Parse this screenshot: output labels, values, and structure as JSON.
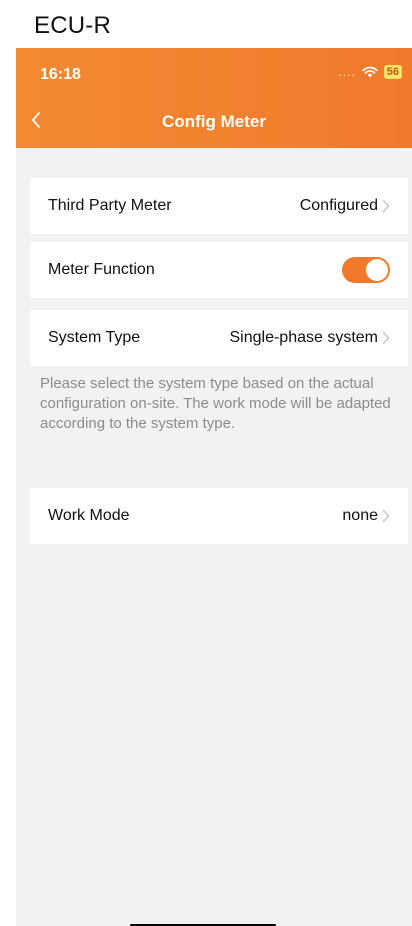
{
  "caption": "ECU-R",
  "status": {
    "time": "16:18",
    "signal": "....",
    "battery": "56"
  },
  "nav": {
    "title": "Config Meter"
  },
  "rows": {
    "third_party": {
      "label": "Third Party Meter",
      "value": "Configured"
    },
    "meter_function": {
      "label": "Meter Function",
      "enabled": true
    },
    "system_type": {
      "label": "System Type",
      "value": "Single-phase system"
    },
    "work_mode": {
      "label": "Work Mode",
      "value": "none"
    }
  },
  "note": "Please select the system type based on the actual configuration on-site. The work mode will be adapted according to the system type.",
  "colors": {
    "accent": "#f07a2a",
    "background": "#f2f2f4",
    "note_text": "#8c8c8c"
  },
  "icons": {
    "back": "chevron-left-icon",
    "row": "chevron-right-icon",
    "wifi": "wifi-icon",
    "battery": "battery-icon"
  }
}
